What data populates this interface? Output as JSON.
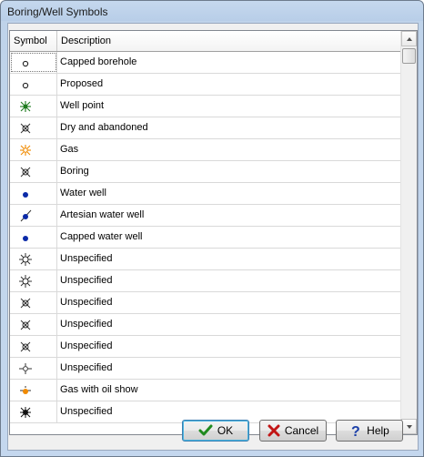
{
  "window": {
    "title": "Boring/Well Symbols"
  },
  "table": {
    "columns": [
      "Symbol",
      "Description"
    ],
    "rows": [
      {
        "icon": "small-circle-icon",
        "description": "Capped borehole"
      },
      {
        "icon": "small-circle-icon",
        "description": "Proposed"
      },
      {
        "icon": "green-starburst-icon",
        "description": "Well point"
      },
      {
        "icon": "crossed-circle-icon",
        "description": "Dry and abandoned"
      },
      {
        "icon": "orange-starburst-icon",
        "description": "Gas"
      },
      {
        "icon": "crossed-circle-icon",
        "description": "Boring"
      },
      {
        "icon": "filled-dot-icon",
        "description": "Water well"
      },
      {
        "icon": "slashed-dot-icon",
        "description": "Artesian water well"
      },
      {
        "icon": "filled-dot-icon",
        "description": "Capped water well"
      },
      {
        "icon": "spiked-circle-icon",
        "description": "Unspecified"
      },
      {
        "icon": "spiked-circle-icon",
        "description": "Unspecified"
      },
      {
        "icon": "crossed-circle-icon",
        "description": "Unspecified"
      },
      {
        "icon": "crossed-circle-icon",
        "description": "Unspecified"
      },
      {
        "icon": "crossed-circle-icon",
        "description": "Unspecified"
      },
      {
        "icon": "dashed-circle-icon",
        "description": "Unspecified"
      },
      {
        "icon": "orange-oil-gas-icon",
        "description": "Gas with oil show"
      },
      {
        "icon": "black-spiked-dot-icon",
        "description": "Unspecified"
      }
    ]
  },
  "buttons": {
    "ok": "OK",
    "cancel": "Cancel",
    "help": "Help"
  },
  "colors": {
    "title_bar": "#b8cee8",
    "water_blue": "#0b2aa8",
    "gas_orange": "#f08a00",
    "well_green": "#1d7a1d"
  }
}
